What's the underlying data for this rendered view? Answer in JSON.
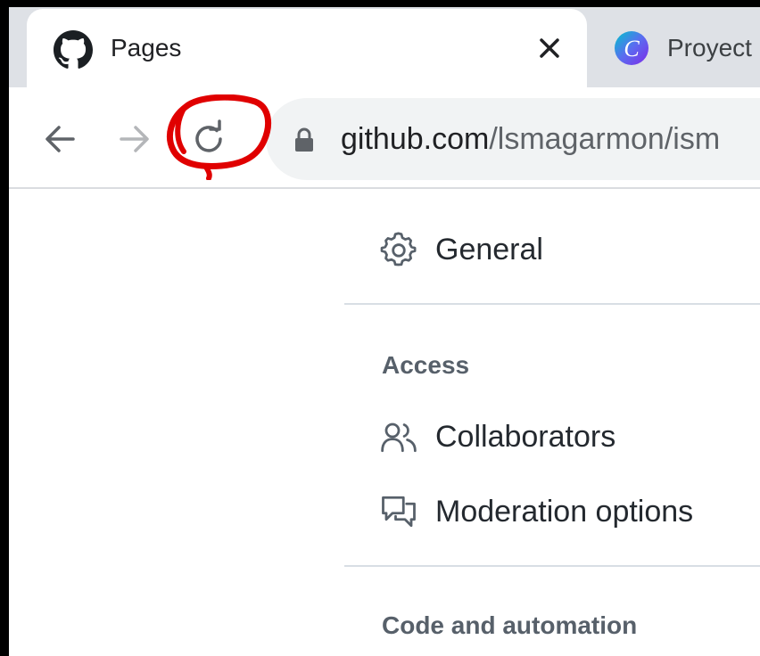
{
  "browser": {
    "tabs": [
      {
        "title": "Pages",
        "favicon": "github-icon",
        "active": true
      },
      {
        "title": "Proyect",
        "favicon": "canva-icon",
        "active": false
      }
    ],
    "close_icon": "close-icon",
    "nav": {
      "back": "back-arrow-icon",
      "forward": "forward-arrow-icon",
      "reload": "reload-icon"
    },
    "address_bar": {
      "domain": "github.com",
      "path": "/lsmagarmon/ism",
      "lock": "lock-icon"
    },
    "annotation_color": "#e00000"
  },
  "settings_menu": {
    "general": {
      "label": "General",
      "icon": "gear-icon"
    },
    "access_heading": "Access",
    "collaborators": {
      "label": "Collaborators",
      "icon": "people-icon"
    },
    "moderation": {
      "label": "Moderation options",
      "icon": "comment-discussion-icon"
    },
    "code_heading": "Code and automation"
  }
}
